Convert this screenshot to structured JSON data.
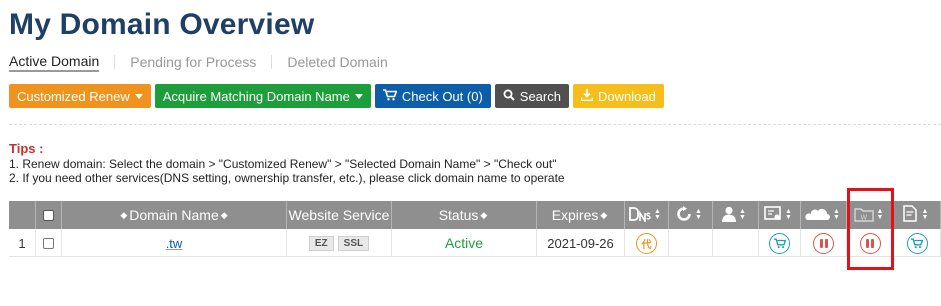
{
  "page": {
    "title": "My Domain Overview"
  },
  "tabs": [
    {
      "label": "Active Domain",
      "active": true
    },
    {
      "label": "Pending for Process",
      "active": false
    },
    {
      "label": "Deleted Domain",
      "active": false
    }
  ],
  "toolbar": {
    "customized_renew": "Customized Renew",
    "acquire_matching": "Acquire Matching Domain Name",
    "check_out": "Check Out (0)",
    "search": "Search",
    "download": "Download"
  },
  "tips": {
    "title": "Tips :",
    "lines": [
      "1. Renew domain: Select the domain > \"Customized Renew\" > \"Selected Domain Name\" > \"Check out\"",
      "2. If you need other services(DNS setting, ownership transfer, etc.), please click domain name to operate"
    ]
  },
  "table": {
    "headers": {
      "domain_name": "Domain Name",
      "website_service": "Website Service",
      "status": "Status",
      "expires": "Expires"
    },
    "header_icons": [
      "dns-icon",
      "renew-icon",
      "user-icon",
      "certificate-icon",
      "cloud-icon",
      "folder-w-icon",
      "document-icon"
    ],
    "rows": [
      {
        "index": "1",
        "domain": ".tw",
        "services": [
          "EZ",
          "SSL"
        ],
        "status": "Active",
        "expires": "2021-09-26",
        "dns_badge": "代"
      }
    ]
  },
  "colors": {
    "title": "#1f3f66",
    "orange": "#f0921e",
    "green": "#1e9e3b",
    "blue": "#0c5ea8",
    "gray": "#505050",
    "yellow": "#f6be1a",
    "tips_red": "#c9302c",
    "highlight": "#e0131b"
  }
}
